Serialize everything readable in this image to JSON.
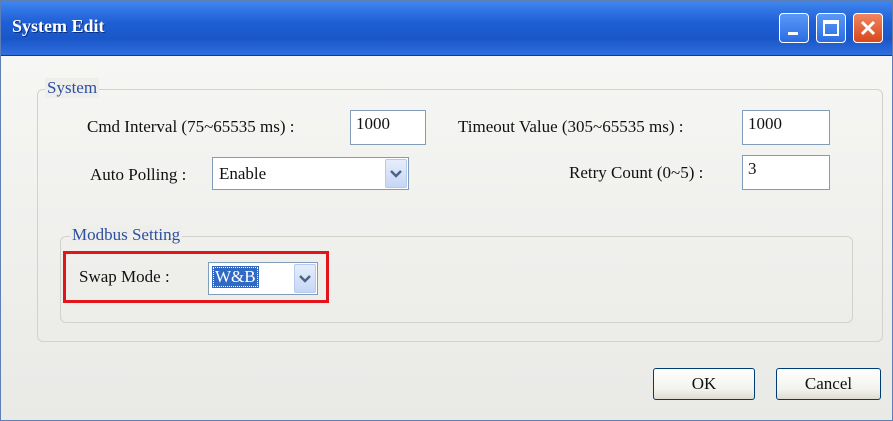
{
  "window": {
    "title": "System Edit"
  },
  "system_group": {
    "legend": "System",
    "cmd_interval": {
      "label": "Cmd Interval (75~65535 ms) :",
      "value": "1000"
    },
    "timeout_value": {
      "label": "Timeout Value (305~65535 ms) :",
      "value": "1000"
    },
    "auto_polling": {
      "label": "Auto Polling :",
      "value": "Enable"
    },
    "retry_count": {
      "label": "Retry Count (0~5) :",
      "value": "3"
    }
  },
  "modbus_group": {
    "legend": "Modbus Setting",
    "swap_mode": {
      "label": "Swap Mode :",
      "value": "W&B"
    }
  },
  "buttons": {
    "ok": "OK",
    "cancel": "Cancel"
  },
  "icons": {
    "minimize": "minimize-icon",
    "maximize": "maximize-icon",
    "close": "close-icon",
    "dropdown": "chevron-down-icon"
  },
  "colors": {
    "titlebar": "#1f5fd6",
    "highlight": "#e3141a",
    "legend_text": "#2d4fa1"
  }
}
